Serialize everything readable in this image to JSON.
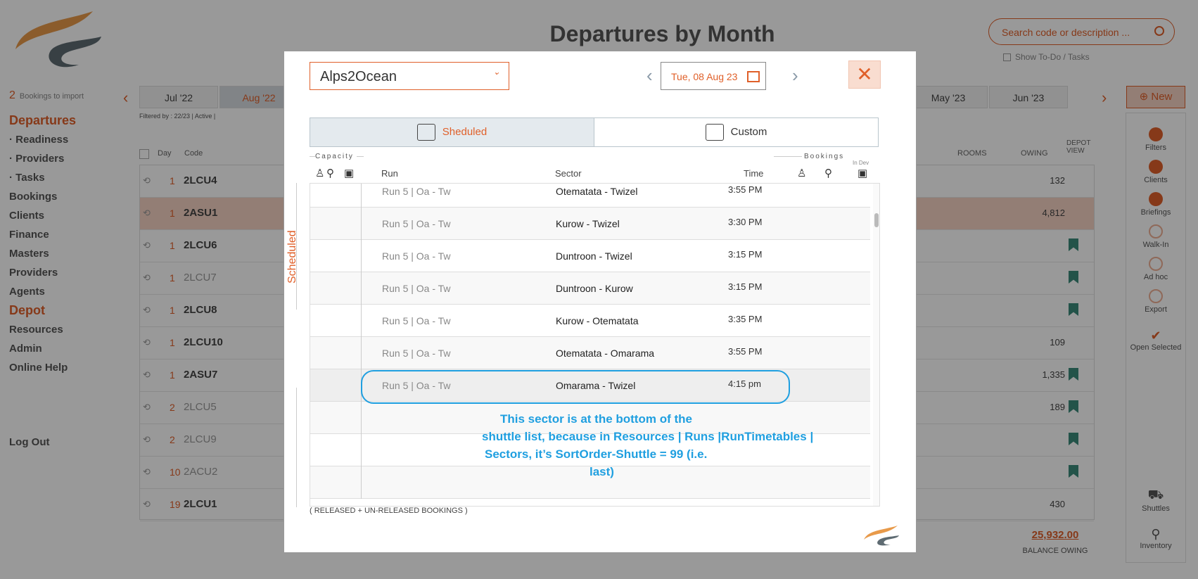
{
  "page": {
    "title": "Departures by Month",
    "import_count": "2",
    "import_label": "Bookings to import",
    "filtered": "Filtered by : 22/23 | Active |",
    "search_placeholder": "Search code or description ...",
    "show_todo": "Show To-Do / Tasks",
    "new_button": "New",
    "logout": "Log Out"
  },
  "nav": {
    "departures": "Departures",
    "readiness": "· Readiness",
    "providers_sub": "· Providers",
    "tasks": "· Tasks",
    "bookings": "Bookings",
    "clients": "Clients",
    "finance": "Finance",
    "masters": "Masters",
    "providers": "Providers",
    "agents": "Agents",
    "depot": "Depot",
    "resources": "Resources",
    "admin": "Admin",
    "online_help": "Online Help"
  },
  "months": [
    "Jul '22",
    "Aug '22",
    "May '23",
    "Jun '23"
  ],
  "grid": {
    "col_day": "Day",
    "col_code": "Code",
    "col_rooms": "ROOMS",
    "col_owing": "OWING",
    "col_depot": "DEPOT VIEW",
    "rows": [
      {
        "day": "1",
        "code": "2LCU4",
        "owing": "132"
      },
      {
        "day": "1",
        "code": "2ASU1",
        "owing": "4,812"
      },
      {
        "day": "1",
        "code": "2LCU6",
        "owing": ""
      },
      {
        "day": "1",
        "code": "2LCU7",
        "owing": ""
      },
      {
        "day": "1",
        "code": "2LCU8",
        "owing": ""
      },
      {
        "day": "1",
        "code": "2LCU10",
        "owing": "109"
      },
      {
        "day": "1",
        "code": "2ASU7",
        "owing": "1,335"
      },
      {
        "day": "2",
        "code": "2LCU5",
        "owing": "189"
      },
      {
        "day": "2",
        "code": "2LCU9",
        "owing": ""
      },
      {
        "day": "10",
        "code": "2ACU2",
        "owing": ""
      },
      {
        "day": "19",
        "code": "2LCU1",
        "owing": "430"
      }
    ],
    "balance": "25,932.00",
    "balance_label": "BALANCE OWING"
  },
  "rightbar": {
    "filters": "Filters",
    "clients": "Clients",
    "briefings": "Briefings",
    "walkin": "Walk-In",
    "adhoc": "Ad hoc",
    "export": "Export",
    "open_selected": "Open Selected",
    "shuttles": "Shuttles",
    "inventory": "Inventory"
  },
  "modal": {
    "tour": "Alps2Ocean",
    "date": "Tue, 08 Aug 23",
    "close": "✕",
    "tab_scheduled": "Sheduled",
    "tab_custom": "Custom",
    "capacity_label": "Capacity",
    "bookings_label": "Bookings",
    "in_dev": "In Dev",
    "col_run": "Run",
    "col_sector": "Sector",
    "col_time": "Time",
    "side_label": "Scheduled",
    "released_note": "( RELEASED + UN-RELEASED BOOKINGS  )",
    "rows": [
      {
        "run": "Run 5 | Oa - Tw",
        "sector": "Otematata - Twizel",
        "time": "3:55  PM"
      },
      {
        "run": "Run 5 | Oa - Tw",
        "sector": "Kurow - Twizel",
        "time": "3:30  PM"
      },
      {
        "run": "Run 5 | Oa - Tw",
        "sector": "Duntroon - Twizel",
        "time": "3:15  PM"
      },
      {
        "run": "Run 5 | Oa - Tw",
        "sector": "Duntroon - Kurow",
        "time": "3:15  PM"
      },
      {
        "run": "Run 5 | Oa - Tw",
        "sector": "Kurow - Otematata",
        "time": "3:35  PM"
      },
      {
        "run": "Run 5 | Oa - Tw",
        "sector": "Otematata - Omarama",
        "time": "3:55  PM"
      },
      {
        "run": "Run 5 | Oa - Tw",
        "sector": "Omarama - Twizel",
        "time": "4:15  pm"
      }
    ],
    "note_lines": [
      "This sector is at the bottom of the",
      "shuttle list, because in Resources | Runs |RunTimetables |",
      "Sectors, it’s SortOrder-Shuttle = 99 (i.e.",
      "last)"
    ]
  },
  "colors": {
    "accent": "#e0602a",
    "annotation": "#1f9fe0"
  }
}
